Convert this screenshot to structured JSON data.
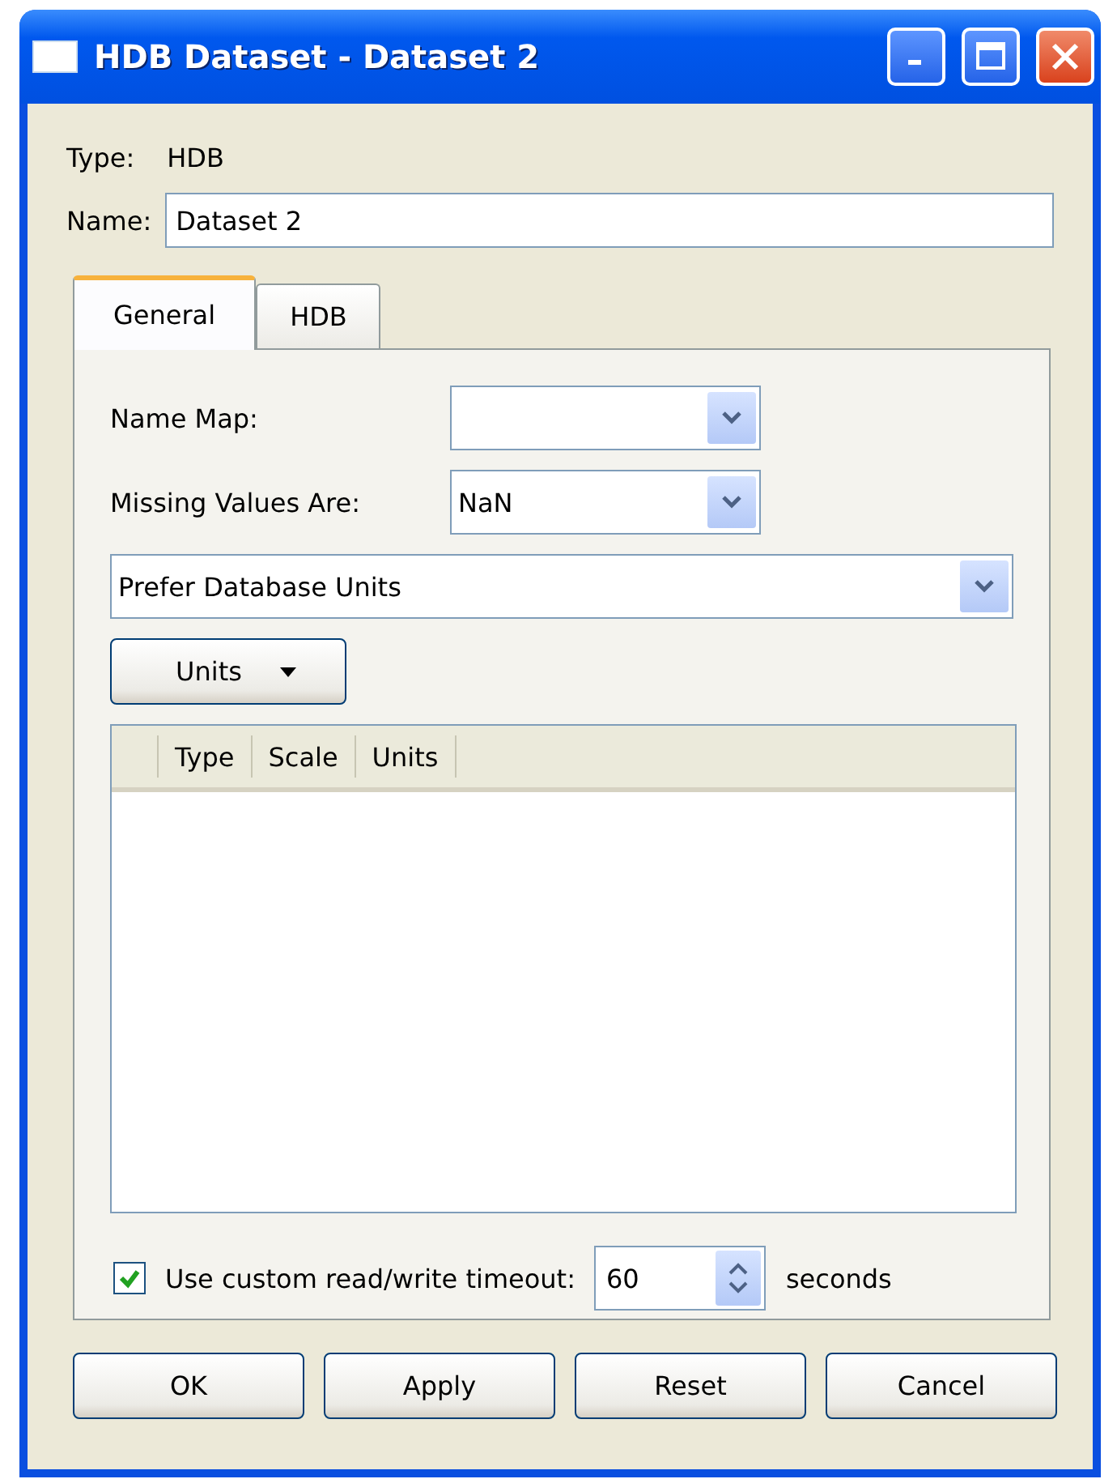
{
  "window": {
    "title": "HDB Dataset - Dataset 2"
  },
  "type": {
    "label": "Type:",
    "value": "HDB"
  },
  "name": {
    "label": "Name:",
    "value": "Dataset 2"
  },
  "tabs": [
    {
      "label": "General",
      "selected": true
    },
    {
      "label": "HDB",
      "selected": false
    }
  ],
  "general": {
    "name_map": {
      "label": "Name Map:"
    },
    "missing_values": {
      "label": "Missing Values Are:",
      "value": "NaN"
    },
    "units_preference": {
      "value": "Prefer Database Units"
    },
    "units_button": {
      "label": "Units"
    },
    "table": {
      "columns": [
        "Type",
        "Scale",
        "Units"
      ]
    },
    "timeout": {
      "checked": true,
      "label": "Use custom read/write timeout:",
      "value": "60",
      "suffix": "seconds"
    }
  },
  "buttons": [
    "OK",
    "Apply",
    "Reset",
    "Cancel"
  ]
}
